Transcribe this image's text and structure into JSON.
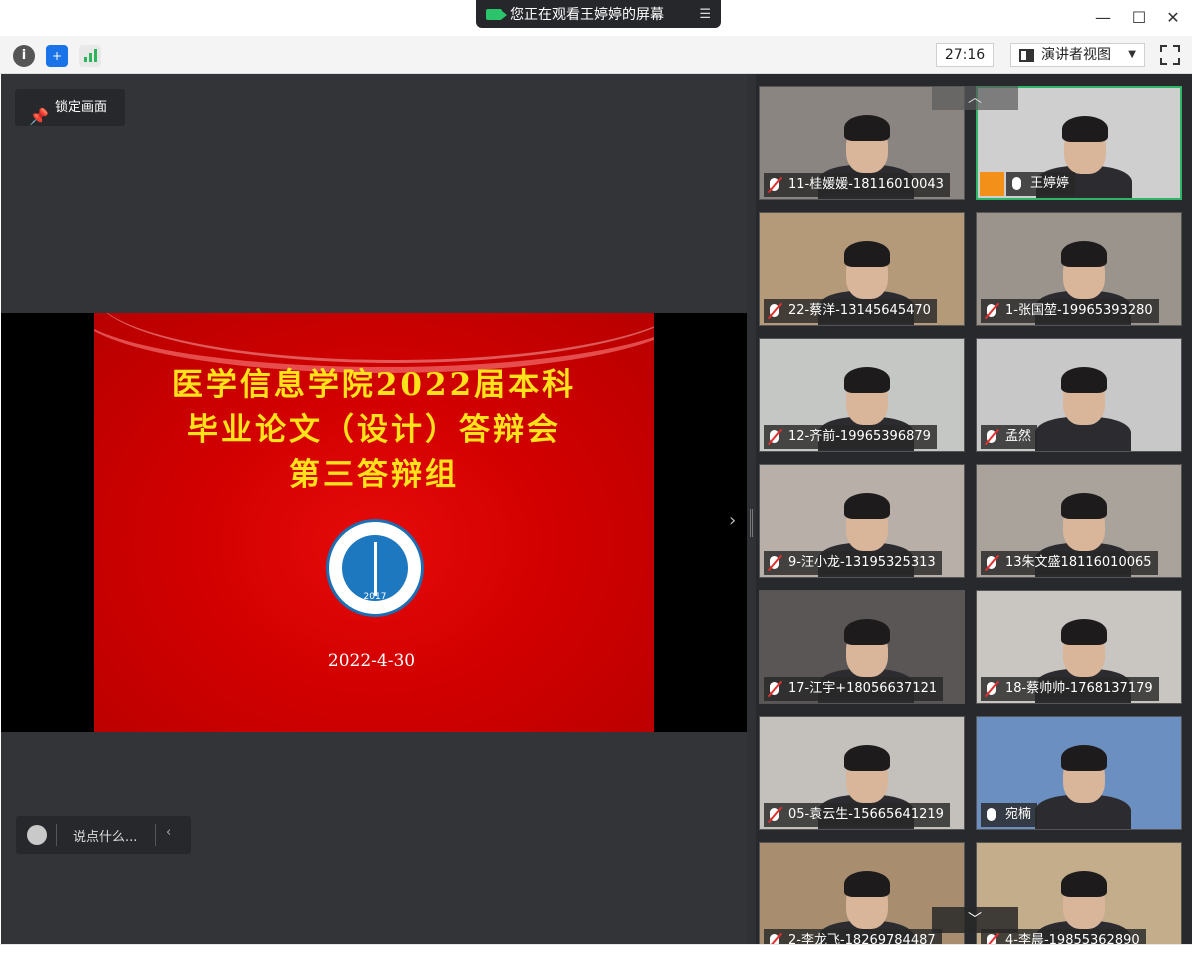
{
  "banner": {
    "text": "您正在观看王婷婷的屏幕",
    "menu_icon": "list-icon"
  },
  "window": {
    "minimize": "—",
    "maximize": "☐",
    "close": "✕"
  },
  "toolbar": {
    "timer": "27:16",
    "view_label": "演讲者视图",
    "icons": [
      "info-icon",
      "shield-icon",
      "signal-icon"
    ]
  },
  "stage": {
    "lock_label": "锁定画面",
    "chat_placeholder": "说点什么...",
    "slide": {
      "title_line1": "医学信息学院2022届本科",
      "title_line2": "毕业论文（设计）答辩会",
      "title_line3": "第三答辩组",
      "logo_year": "2017",
      "date": "2022-4-30"
    }
  },
  "gallery": {
    "participants": [
      {
        "name": "11-桂媛媛-18116010043",
        "muted": true
      },
      {
        "name": "王婷婷",
        "muted": false,
        "host": true
      },
      {
        "name": "22-蔡洋-13145645470",
        "muted": true
      },
      {
        "name": "1-张国堃-19965393280",
        "muted": true
      },
      {
        "name": "12-齐前-19965396879",
        "muted": true
      },
      {
        "name": "孟然",
        "muted": true
      },
      {
        "name": "9-汪小龙-13195325313",
        "muted": true
      },
      {
        "name": "13朱文盛18116010065",
        "muted": true
      },
      {
        "name": "17-江宇+18056637121",
        "muted": true
      },
      {
        "name": "18-蔡帅帅-1768137179",
        "muted": true
      },
      {
        "name": "05-袁云生-15665641219",
        "muted": true
      },
      {
        "name": "宛楠",
        "muted": false
      },
      {
        "name": "2-李龙飞-18269784487",
        "muted": true
      },
      {
        "name": "4-李晨-19855362890",
        "muted": true
      }
    ]
  }
}
